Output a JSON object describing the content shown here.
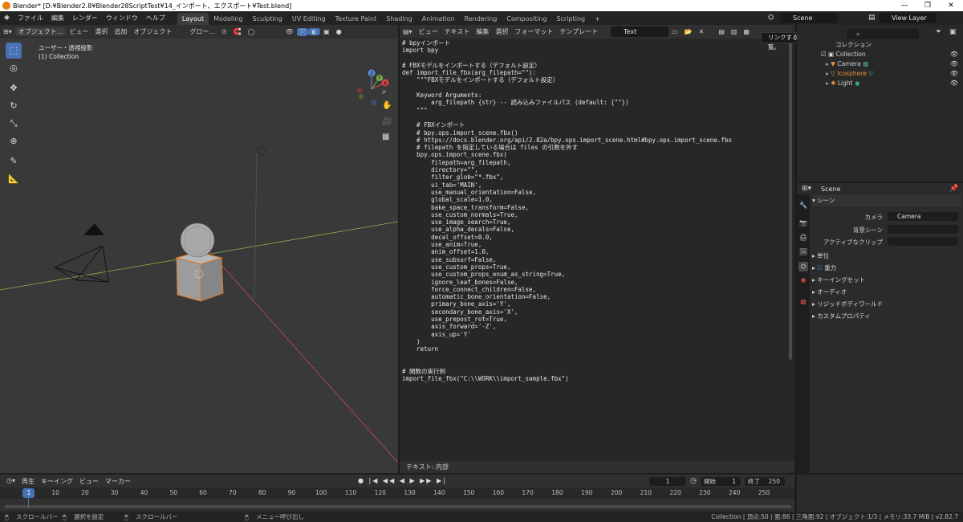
{
  "window": {
    "title": "Blender* [D:¥Blender2.8¥Blender28ScriptTest¥14_インポート、エクスポート¥Test.blend]",
    "minimize": "—",
    "maximize": "❐",
    "close": "✕"
  },
  "menu": [
    "ファイル",
    "編集",
    "レンダー",
    "ウィンドウ",
    "ヘルプ"
  ],
  "workspaces": [
    "Layout",
    "Modeling",
    "Sculpting",
    "UV Editing",
    "Texture Paint",
    "Shading",
    "Animation",
    "Rendering",
    "Compositing",
    "Scripting"
  ],
  "workspace_add": "+",
  "scene": {
    "value": "Scene",
    "view_layer": "View Layer"
  },
  "viewport": {
    "header": [
      "オブジェクト...",
      "ビュー",
      "選択",
      "追加",
      "オブジェクト"
    ],
    "transform": "グロー...",
    "view_label": "ユーザー・透視投影",
    "collection_label": "(1) Collection",
    "axes": {
      "x": "X",
      "y": "Y",
      "z": "Z"
    }
  },
  "text_editor": {
    "header": [
      "ビュー",
      "テキスト",
      "編集",
      "選択",
      "フォーマット",
      "テンプレート"
    ],
    "text_name": "Text",
    "footer": "テキスト: 内部",
    "tooltip": "リンクするシーンを閲覧。",
    "code": "# bpyインポート\nimport bpy\n\n# FBXモデルをインポートする（デフォルト設定）\ndef import_file_fbx(arg_filepath=\"\"):\n    \"\"\"FBXモデルをインポートする（デフォルト設定）\n\n    Keyword Arguments:\n        arg_filepath {str} -- 読み込みファイルパス (default: {\"\"})\n    \"\"\"\n\n    # FBXインポート\n    # bpy.ops.import_scene.fbx()\n    # https://docs.blender.org/api/2.82a/bpy.ops.import_scene.html#bpy.ops.import_scene.fbx\n    # filepath を指定している場合は files の引数を外す\n    bpy.ops.import_scene.fbx(\n        filepath=arg_filepath,\n        directory=\"\",\n        filter_glob=\"*.fbx\",\n        ui_tab='MAIN',\n        use_manual_orientation=False,\n        global_scale=1.0,\n        bake_space_transform=False,\n        use_custom_normals=True,\n        use_image_search=True,\n        use_alpha_decals=False,\n        decal_offset=0.0,\n        use_anim=True,\n        anim_offset=1.0,\n        use_subsurf=False,\n        use_custom_props=True,\n        use_custom_props_enum_as_string=True,\n        ignore_leaf_bones=False,\n        force_connect_children=False,\n        automatic_bone_orientation=False,\n        primary_bone_axis='Y',\n        secondary_bone_axis='X',\n        use_prepost_rot=True,\n        axis_forward='-Z',\n        axis_up='Y'\n    )\n    return\n\n\n# 関数の実行例\nimport_file_fbx(\"C:\\\\WORK\\\\import_sample.fbx\")"
  },
  "outliner": {
    "header": "コレクション",
    "items": [
      {
        "name": "Collection"
      },
      {
        "name": "Camera"
      },
      {
        "name": "Icosphere"
      },
      {
        "name": "Light"
      }
    ]
  },
  "properties": {
    "scene_name": "Scene",
    "section": "シーン",
    "camera_label": "カメラ",
    "camera_value": "Camera",
    "background_label": "背景シーン",
    "clip_label": "アクティブなクリップ",
    "panels": [
      "単位",
      "重力",
      "キーイングセット",
      "オーディオ",
      "リジッドボディワールド",
      "カスタムプロパティ"
    ]
  },
  "timeline": {
    "header": [
      "再生",
      "キーイング",
      "ビュー",
      "マーカー"
    ],
    "current_frame": "1",
    "start_label": "開始",
    "start_value": "1",
    "end_label": "終了",
    "end_value": "250",
    "ticks": [
      "1",
      "10",
      "20",
      "30",
      "40",
      "50",
      "60",
      "70",
      "80",
      "90",
      "100",
      "110",
      "120",
      "130",
      "140",
      "150",
      "160",
      "170",
      "180",
      "190",
      "200",
      "210",
      "220",
      "230",
      "240",
      "250"
    ]
  },
  "status": {
    "left1": "スクロールバー",
    "left2": "選択を設定",
    "left3": "スクロールバー",
    "middle": "メニュー呼び出し",
    "stats": "Collection | 頂点:50 | 面:86 | 三角面:92 | オブジェクト:1/3 | メモリ:33.7 MiB | v2.82.7"
  }
}
